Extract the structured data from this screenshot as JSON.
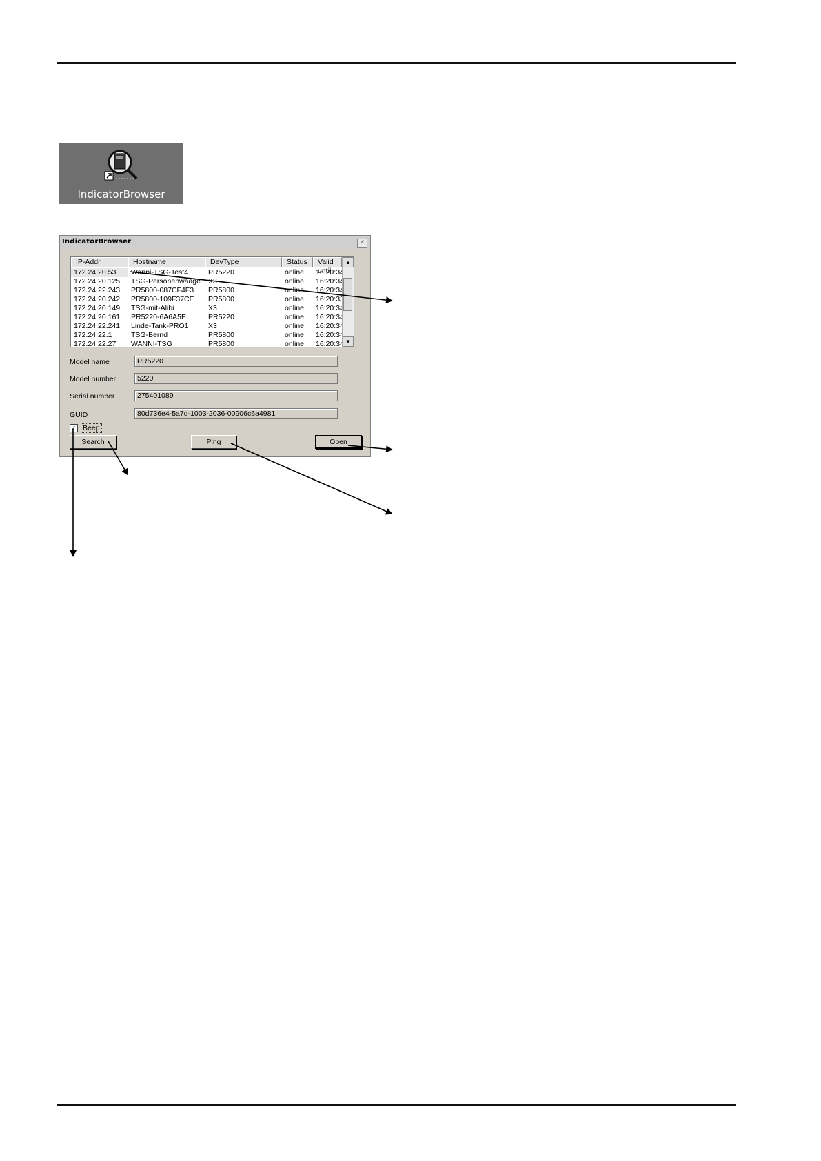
{
  "shortcut": {
    "label": "IndicatorBrowser",
    "icon": "magnifier-indicator-icon"
  },
  "dialog": {
    "title": "IndicatorBrowser",
    "close_glyph": "×",
    "columns": [
      "IP-Addr",
      "Hostname",
      "DevType",
      "Status",
      "Valid until"
    ],
    "rows": [
      [
        "172.24.20.53",
        "Wanni-TSG-Test4",
        "PR5220",
        "online",
        "16:20:34"
      ],
      [
        "172.24.20.125",
        "TSG-Personenwaage",
        "X3",
        "online",
        "16:20:34"
      ],
      [
        "172.24.22.243",
        "PR5800-087CF4F3",
        "PR5800",
        "online",
        "16:20:34"
      ],
      [
        "172.24.20.242",
        "PR5800-109F37CE",
        "PR5800",
        "online",
        "16:20:33"
      ],
      [
        "172.24.20.149",
        "TSG-mit-Alibi",
        "X3",
        "online",
        "16:20:34"
      ],
      [
        "172.24.20.161",
        "PR5220-6A6A5E",
        "PR5220",
        "online",
        "16:20:34"
      ],
      [
        "172.24.22.241",
        "Linde-Tank-PRO1",
        "X3",
        "online",
        "16:20:34"
      ],
      [
        "172.24.22.1",
        "TSG-Bernd",
        "PR5800",
        "online",
        "16:20:34"
      ],
      [
        "172.24.22.27",
        "WANNI-TSG",
        "PR5800",
        "online",
        "16:20:34"
      ]
    ],
    "fields": {
      "model_name": {
        "label": "Model name",
        "value": "PR5220"
      },
      "model_number": {
        "label": "Model number",
        "value": "5220"
      },
      "serial_number": {
        "label": "Serial number",
        "value": "275401089"
      },
      "guid": {
        "label": "GUID",
        "value": "80d736e4-5a7d-1003-2036-00906c6a4981"
      }
    },
    "beep": {
      "label": "Beep",
      "checked": true,
      "check_glyph": "✓"
    },
    "buttons": {
      "search": "Search",
      "ping": "Ping",
      "open": "Open"
    },
    "scroll": {
      "up_glyph": "▲",
      "down_glyph": "▼"
    }
  }
}
